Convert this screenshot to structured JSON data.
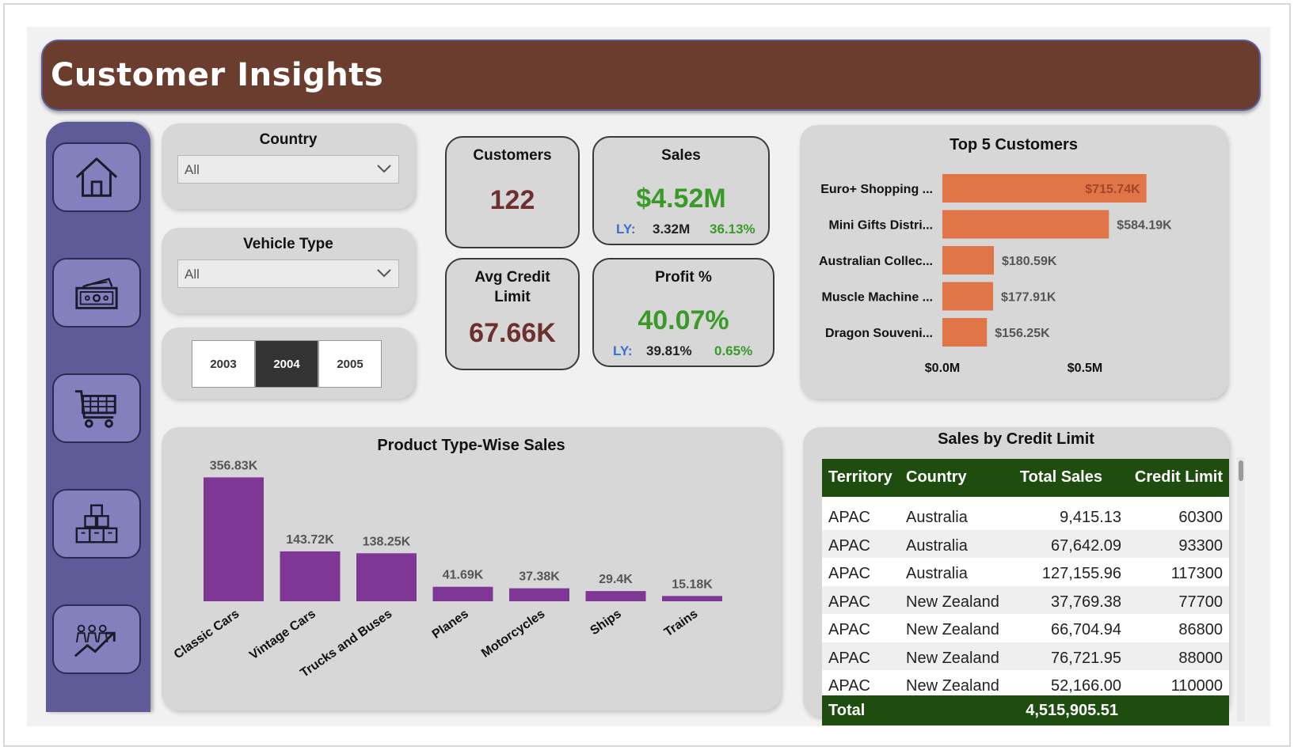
{
  "header": {
    "title": "Customer Insights"
  },
  "colors": {
    "header": "#6b3d2e",
    "sidebar": "#5f5b99",
    "bar_product": "#7e3794",
    "bar_customer": "#e07548",
    "table_header": "#1f4d10",
    "kpi_sales": "#3a9a28",
    "kpi_customers": "#6e2f2f",
    "ly_label": "#3a6fd0"
  },
  "sidebar": {
    "items": [
      {
        "name": "home",
        "icon": "home-icon"
      },
      {
        "name": "sales",
        "icon": "money-icon"
      },
      {
        "name": "orders",
        "icon": "cart-icon"
      },
      {
        "name": "products",
        "icon": "boxes-icon"
      },
      {
        "name": "customers",
        "icon": "people-growth-icon"
      }
    ]
  },
  "filters": {
    "country": {
      "label": "Country",
      "value": "All"
    },
    "vehicle_type": {
      "label": "Vehicle Type",
      "value": "All"
    },
    "years": [
      "2003",
      "2004",
      "2005"
    ],
    "selected_year": "2004"
  },
  "kpis": {
    "customers": {
      "label": "Customers",
      "value": "122"
    },
    "sales": {
      "label": "Sales",
      "value": "$4.52M",
      "ly_label": "LY:",
      "ly_value": "3.32M",
      "change": "36.13%"
    },
    "avg_credit": {
      "label_line1": "Avg Credit",
      "label_line2": "Limit",
      "value": "67.66K"
    },
    "profit": {
      "label": "Profit %",
      "value": "40.07%",
      "ly_label": "LY:",
      "ly_value": "39.81%",
      "change": "0.65%"
    }
  },
  "top_customers": {
    "title": "Top 5 Customers",
    "axis_labels": [
      "$0.0M",
      "$0.5M"
    ]
  },
  "product_sales": {
    "title": "Product Type-Wise Sales"
  },
  "chart_data": [
    {
      "type": "bar",
      "orientation": "horizontal",
      "title": "Top 5 Customers",
      "categories": [
        "Euro+ Shopping ...",
        "Mini Gifts Distri...",
        "Australian Collec...",
        "Muscle Machine ...",
        "Dragon Souveni..."
      ],
      "values": [
        715.74,
        584.19,
        180.59,
        177.91,
        156.25
      ],
      "data_labels": [
        "$715.74K",
        "$584.19K",
        "$180.59K",
        "$177.91K",
        "$156.25K"
      ],
      "xlim": [
        0,
        1000
      ],
      "ticks": [
        "$0.0M",
        "$0.5M"
      ]
    },
    {
      "type": "bar",
      "title": "Product Type-Wise Sales",
      "categories": [
        "Classic Cars",
        "Vintage Cars",
        "Trucks and Buses",
        "Planes",
        "Motorcycles",
        "Ships",
        "Trains"
      ],
      "values": [
        356.83,
        143.72,
        138.25,
        41.69,
        37.38,
        29.4,
        15.18
      ],
      "data_labels": [
        "356.83K",
        "143.72K",
        "138.25K",
        "41.69K",
        "37.38K",
        "29.4K",
        "15.18K"
      ],
      "ylim": [
        0,
        360
      ]
    }
  ],
  "credit_table": {
    "title": "Sales by Credit Limit",
    "columns": [
      "Territory",
      "Country",
      "Total Sales",
      "Credit Limit"
    ],
    "rows": [
      [
        "APAC",
        "Australia",
        "9,415.13",
        "60300"
      ],
      [
        "APAC",
        "Australia",
        "67,642.09",
        "93300"
      ],
      [
        "APAC",
        "Australia",
        "127,155.96",
        "117300"
      ],
      [
        "APAC",
        "New Zealand",
        "37,769.38",
        "77700"
      ],
      [
        "APAC",
        "New Zealand",
        "66,704.94",
        "86800"
      ],
      [
        "APAC",
        "New Zealand",
        "76,721.95",
        "88000"
      ],
      [
        "APAC",
        "New Zealand",
        "52,166.00",
        "110000"
      ]
    ],
    "total_label": "Total",
    "total_value": "4,515,905.51"
  }
}
